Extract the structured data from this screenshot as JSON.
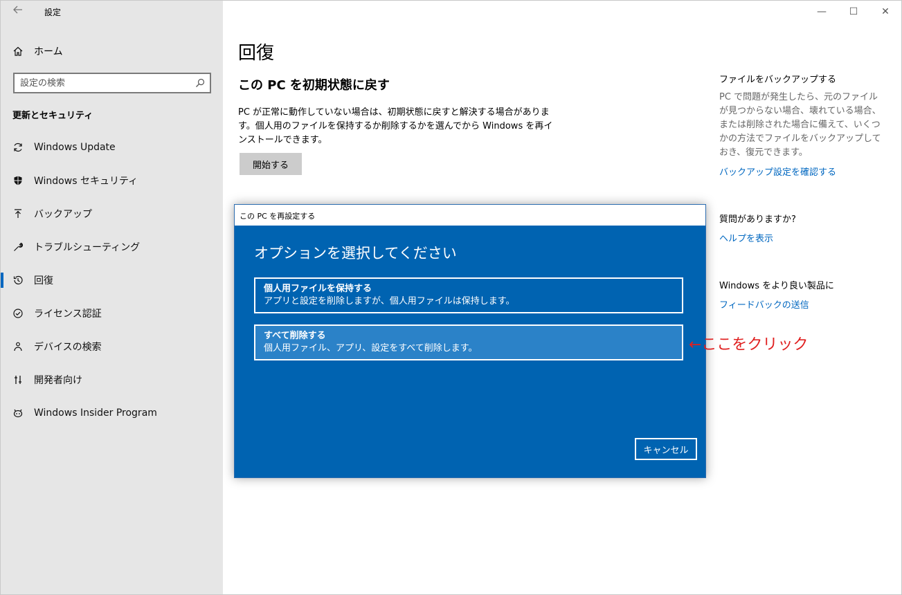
{
  "window": {
    "title": "設定",
    "controls": {
      "minimize": "—",
      "maximize": "☐",
      "close": "✕"
    }
  },
  "sidebar": {
    "home_label": "ホーム",
    "search_placeholder": "設定の検索",
    "section_title": "更新とセキュリティ",
    "items": [
      {
        "label": "Windows Update",
        "icon": "refresh-icon",
        "active": false
      },
      {
        "label": "Windows セキュリティ",
        "icon": "shield-icon",
        "active": false
      },
      {
        "label": "バックアップ",
        "icon": "backup-icon",
        "active": false
      },
      {
        "label": "トラブルシューティング",
        "icon": "wrench-icon",
        "active": false
      },
      {
        "label": "回復",
        "icon": "history-icon",
        "active": true
      },
      {
        "label": "ライセンス認証",
        "icon": "check-circle-icon",
        "active": false
      },
      {
        "label": "デバイスの検索",
        "icon": "person-locate-icon",
        "active": false
      },
      {
        "label": "開発者向け",
        "icon": "developer-icon",
        "active": false
      },
      {
        "label": "Windows Insider Program",
        "icon": "insider-cat-icon",
        "active": false
      }
    ]
  },
  "main": {
    "page_title": "回復",
    "reset_title": "この PC を初期状態に戻す",
    "reset_desc": "PC が正常に動作していない場合は、初期状態に戻すと解決する場合があります。個人用のファイルを保持するか削除するかを選んでから Windows を再インストールできます。",
    "start_button": "開始する"
  },
  "right": {
    "backup_title": "ファイルをバックアップする",
    "backup_text": "PC で問題が発生したら、元のファイルが見つからない場合、壊れている場合、または削除された場合に備えて、いくつかの方法でファイルをバックアップしておき、復元できます。",
    "backup_link": "バックアップ設定を確認する",
    "question_title": "質問がありますか?",
    "help_link": "ヘルプを表示",
    "improve_title": "Windows をより良い製品に",
    "feedback_link": "フィードバックの送信"
  },
  "dialog": {
    "title": "この PC を再設定する",
    "heading": "オプションを選択してください",
    "options": [
      {
        "title": "個人用ファイルを保持する",
        "desc": "アプリと設定を削除しますが、個人用ファイルは保持します。"
      },
      {
        "title": "すべて削除する",
        "desc": "個人用ファイル、アプリ、設定をすべて削除します。"
      }
    ],
    "cancel": "キャンセル"
  },
  "annotation": "←ここをクリック",
  "colors": {
    "accent": "#0067c0",
    "dialog_bg": "#0063b1",
    "annotation": "#e02020"
  }
}
